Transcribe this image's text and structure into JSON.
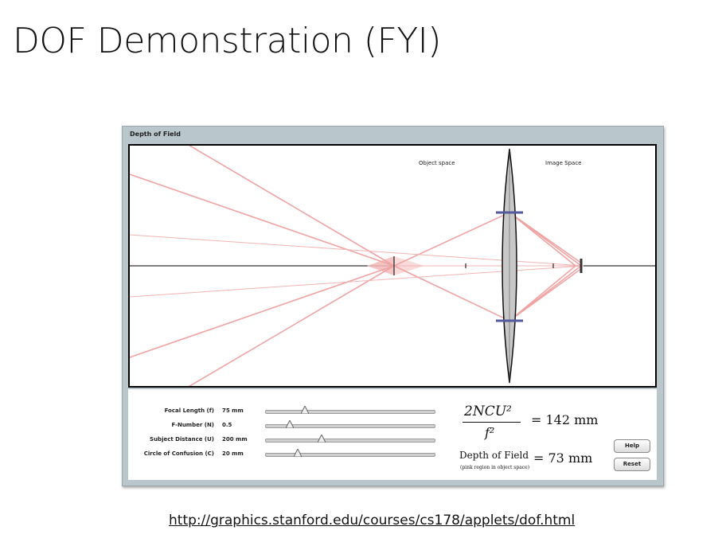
{
  "slide": {
    "title": "DOF Demonstration (FYI)",
    "link": "http://graphics.stanford.edu/courses/cs178/applets/dof.html"
  },
  "applet": {
    "title": "Depth of Field",
    "labels": {
      "object_space": "Object space",
      "image_space": "Image Space"
    },
    "controls": [
      {
        "label": "Focal Length (f)",
        "value": "75 mm",
        "slider_fraction": 0.23
      },
      {
        "label": "F-Number (N)",
        "value": "0.5",
        "slider_fraction": 0.14
      },
      {
        "label": "Subject Distance (U)",
        "value": "200 mm",
        "slider_fraction": 0.33
      },
      {
        "label": "Circle of Confusion (C)",
        "value": "20 mm",
        "slider_fraction": 0.19
      }
    ],
    "formula": {
      "numerator": "2NCU²",
      "denominator": "f²",
      "result1": "= 142 mm",
      "dof_label": "Depth of Field",
      "dof_note": "(pink region in object space)",
      "result2": "= 73 mm"
    },
    "buttons": {
      "help": "Help",
      "reset": "Reset"
    },
    "colors": {
      "ray": "#f0a3a3",
      "lens_fill": "#c8c8c8",
      "aperture": "#555a9e",
      "frame": "#b9c6cc"
    }
  }
}
